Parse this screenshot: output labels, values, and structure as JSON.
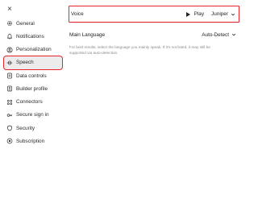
{
  "close_label": "×",
  "sidebar": {
    "items": [
      {
        "label": "General",
        "icon": "gear-icon"
      },
      {
        "label": "Notifications",
        "icon": "bell-icon"
      },
      {
        "label": "Personalization",
        "icon": "person-icon"
      },
      {
        "label": "Speech",
        "icon": "waveform-icon",
        "active": true
      },
      {
        "label": "Data controls",
        "icon": "database-icon"
      },
      {
        "label": "Builder profile",
        "icon": "id-card-icon"
      },
      {
        "label": "Connectors",
        "icon": "grid-icon"
      },
      {
        "label": "Secure sign in",
        "icon": "key-icon"
      },
      {
        "label": "Security",
        "icon": "shield-icon"
      },
      {
        "label": "Subscription",
        "icon": "circle-dot-icon"
      }
    ]
  },
  "main": {
    "voice": {
      "label": "Voice",
      "play_label": "Play",
      "selected": "Juniper"
    },
    "language": {
      "label": "Main Language",
      "selected": "Auto-Detect",
      "help": "For best results, select the language you mainly speak. If it's not listed, it may still be supported via auto-detection."
    }
  },
  "colors": {
    "highlight": "#e5242b",
    "active_bg": "#ececec"
  }
}
